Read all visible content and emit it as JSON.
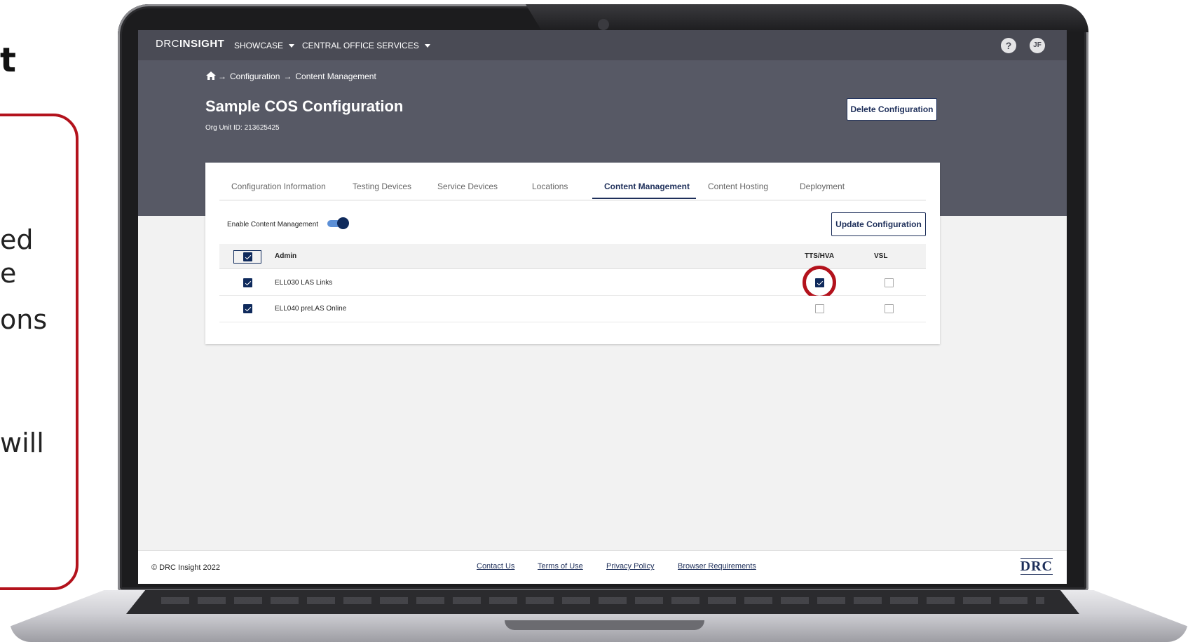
{
  "slide": {
    "title_fragment": "t",
    "note_fragments": [
      "ed",
      "e",
      "ons",
      "will"
    ]
  },
  "app": {
    "logo_prefix": "DRC",
    "logo_name": "INSIGHT",
    "nav": [
      {
        "label": "SHOWCASE"
      },
      {
        "label": "CENTRAL OFFICE SERVICES"
      }
    ],
    "help_label": "?",
    "avatar_initials": "JF"
  },
  "breadcrumb": {
    "items": [
      "Configuration",
      "Content Management"
    ]
  },
  "page": {
    "title": "Sample COS Configuration",
    "org_unit": "Org Unit ID: 213625425",
    "delete_label": "Delete Configuration"
  },
  "tabs": [
    {
      "label": "Configuration Information",
      "active": false
    },
    {
      "label": "Testing Devices",
      "active": false
    },
    {
      "label": "Service Devices",
      "active": false
    },
    {
      "label": "Locations",
      "active": false
    },
    {
      "label": "Content Management",
      "active": true
    },
    {
      "label": "Content Hosting",
      "active": false
    },
    {
      "label": "Deployment",
      "active": false
    }
  ],
  "content_management": {
    "toggle_label": "Enable Content Management",
    "toggle_on": true,
    "update_label": "Update Configuration",
    "columns": {
      "admin": "Admin",
      "tts": "TTS/HVA",
      "vsl": "VSL"
    },
    "header_checked": true,
    "rows": [
      {
        "name": "ELL030 LAS Links",
        "selected": true,
        "tts": true,
        "vsl": false
      },
      {
        "name": "ELL040 preLAS Online",
        "selected": true,
        "tts": false,
        "vsl": false
      }
    ]
  },
  "footer": {
    "copyright": "© DRC Insight 2022",
    "links": [
      "Contact Us",
      "Terms of Use",
      "Privacy Policy",
      "Browser Requirements"
    ],
    "logo_text": "DRC"
  },
  "colors": {
    "accent": "#0f2a5c",
    "highlight": "#b3121c",
    "header_bg": "#575965",
    "topbar_bg": "#4a4b55"
  }
}
